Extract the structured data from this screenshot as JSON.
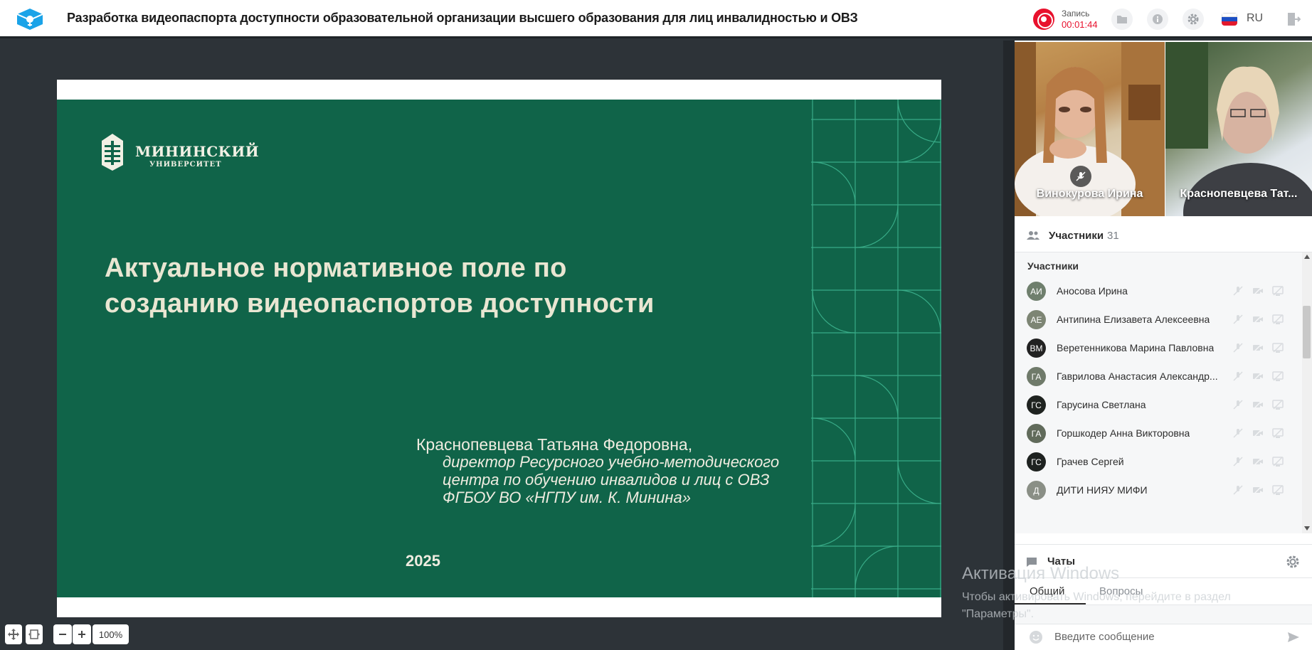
{
  "app": {
    "title": "Разработка видеопаспорта доступности образовательной организации высшего образования для лиц инвалидностью и ОВЗ"
  },
  "toolbar": {
    "recording_label": "Запись",
    "recording_time": "00:01:44",
    "language": "RU",
    "icons": [
      "folder-icon",
      "info-icon",
      "gear-icon",
      "flag-ru-icon",
      "exit-icon"
    ]
  },
  "slide": {
    "logo_name": "МИНИНСКИЙ",
    "logo_sub": "УНИВЕРСИТЕТ",
    "title_line1": "Актуальное нормативное поле по",
    "title_line2": "созданию видеопаспортов доступности",
    "speaker": "Краснопевцева Татьяна Федоровна,",
    "role_line1": "директор Ресурсного учебно-методического",
    "role_line2": "центра по обучению инвалидов и лиц с ОВЗ",
    "role_line3": "ФГБОУ ВО «НГПУ им. К. Минина»",
    "year": "2025"
  },
  "zoom": {
    "value": "100%"
  },
  "videos": [
    {
      "name": "Винокурова Ирина",
      "muted": true
    },
    {
      "name": "Краснопевцева Тат...",
      "muted": false
    }
  ],
  "participants": {
    "header_label": "Участники",
    "count": "31",
    "list_title": "Участники",
    "items": [
      {
        "initials": "АИ",
        "name": "Аносова Ирина",
        "color": "#6f7f6d"
      },
      {
        "initials": "АЕ",
        "name": "Антипина Елизавета Алексеевна",
        "color": "#7d8574"
      },
      {
        "initials": "ВМ",
        "name": "Веретенникова Марина Павловна",
        "color": "#222222"
      },
      {
        "initials": "ГА",
        "name": "Гаврилова Анастасия Александр...",
        "color": "#6f7a6a"
      },
      {
        "initials": "ГС",
        "name": "Гарусина Светлана",
        "color": "#1f2320"
      },
      {
        "initials": "ГА",
        "name": "Горшкодер Анна Викторовна",
        "color": "#616b5b"
      },
      {
        "initials": "ГС",
        "name": "Грачев Сергей",
        "color": "#1e2220"
      },
      {
        "initials": "Д",
        "name": "ДИТИ НИЯУ МИФИ",
        "color": "#8a8f86"
      }
    ]
  },
  "chats": {
    "header_label": "Чаты",
    "tabs": [
      "Общий",
      "Вопросы"
    ],
    "input_placeholder": "Введите сообщение"
  },
  "watermark": {
    "title": "Активация Windows",
    "line1": "Чтобы активировать Windows, перейдите в раздел",
    "line2": "\"Параметры\"."
  }
}
